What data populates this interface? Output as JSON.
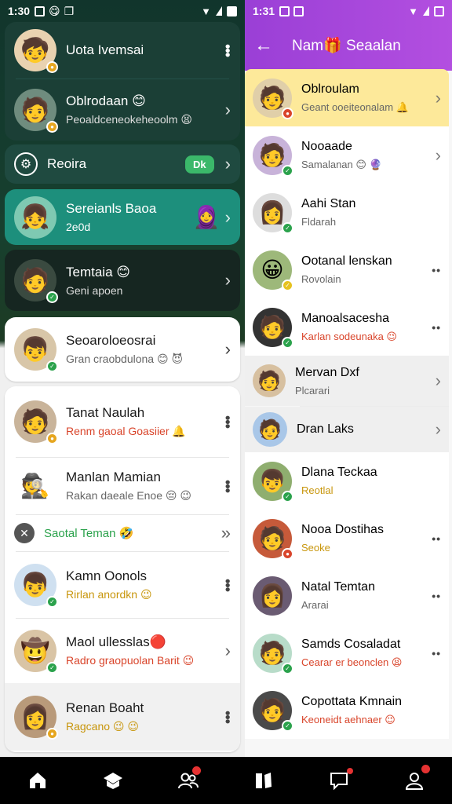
{
  "status": {
    "time_left": "1:30",
    "time_right": "1:31"
  },
  "left": {
    "items": [
      {
        "name": "Uota Ivemsai",
        "sub": ""
      },
      {
        "name": "Oblrodaan 😊",
        "sub": "Peoaldceneokeheoolm 😫"
      },
      {
        "name": "Reoira",
        "pill": "Dk"
      },
      {
        "name": "Sereianls Baoa",
        "sub": "2e0d"
      },
      {
        "name": "Temtaia 😊",
        "sub": "Geni apoen"
      },
      {
        "name": "Seoaroloeosrai",
        "sub": "Gran craobdulona 😊 😈"
      },
      {
        "name": "Tanat Naulah",
        "sub": "Renm gaoal Goasiier 🔔"
      },
      {
        "name": "Manlan Mamian",
        "sub": "Rakan daeale Enoe 😔 😉"
      },
      {
        "name": "Saotal Teman 🤣",
        "sub": ""
      },
      {
        "name": "Kamn Oonols",
        "sub": "Rirlan anordkn 😉"
      },
      {
        "name": "Maol ullesslas🔴",
        "sub": "Radro graopuolan Barit 😉"
      },
      {
        "name": "Renan Boaht",
        "sub": "Ragcano 😉 😉"
      }
    ]
  },
  "right": {
    "title": "Nam🎁 Seaalan",
    "items": [
      {
        "name": "Oblroulam",
        "sub": "Geant ooeiteonalam 🔔"
      },
      {
        "name": "Nooaade",
        "sub": "Samalanan 😊 🔮"
      },
      {
        "name": "Aahi Stan",
        "sub": "Fldarah"
      },
      {
        "name": "Ootanal lenskan",
        "sub": "Rovolain"
      },
      {
        "name": "Manoalsacesha",
        "sub": "Karlan sodeunaka 😉"
      },
      {
        "name": "Mervan Dxf",
        "sub": "Plcarari"
      },
      {
        "name": "Dran Laks",
        "sub": ""
      },
      {
        "name": "Dlana Teckaa",
        "sub": "Reotlal"
      },
      {
        "name": "Nooa Dostihas",
        "sub": "Seoke"
      },
      {
        "name": "Natal Temtan",
        "sub": "Ararai"
      },
      {
        "name": "Samds Cosaladat",
        "sub": "Cearar er beonclen 😫"
      },
      {
        "name": "Copottata Kmnain",
        "sub": "Keoneidt aehnaer 😉"
      }
    ]
  },
  "colors": {
    "left_dark": "#1b3f36",
    "left_teal": "#1d8f7c",
    "right_header": "#a845dc",
    "highlight": "#fde99a",
    "status_green": "#2ba24c",
    "notification_red": "#e53232"
  },
  "icons": {
    "bottom_nav": [
      "home-icon",
      "pad-icon",
      "groups-icon",
      "book-icon",
      "chat-icon",
      "profile-icon"
    ]
  }
}
